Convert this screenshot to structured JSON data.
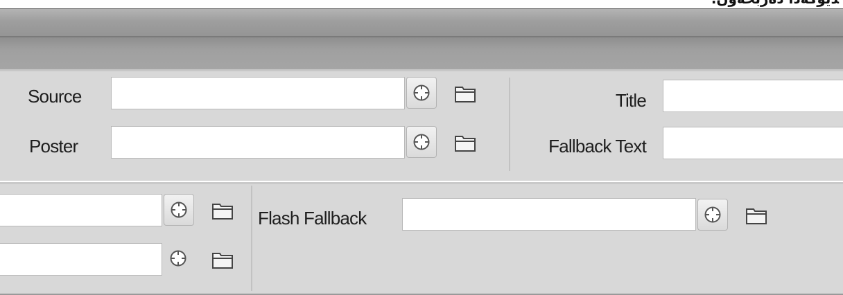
{
  "header": {
    "rtl_title": "ﺪﯾﯚﮐﻪﺩﺍ ﺩﻩﺭﺑﺨﻪﻭﻥ."
  },
  "video_section": {
    "source_label": "Source",
    "source_value": "",
    "poster_label": "Poster",
    "poster_value": "",
    "title_label": "Title",
    "title_value": "",
    "fallback_text_label": "Fallback Text",
    "fallback_text_value": ""
  },
  "fallback_section": {
    "field1_value": "",
    "field2_value": "",
    "flash_fallback_label": "Flash Fallback",
    "flash_fallback_value": ""
  },
  "icons": {
    "target": "crosshair-target-icon",
    "browse": "folder-icon"
  }
}
